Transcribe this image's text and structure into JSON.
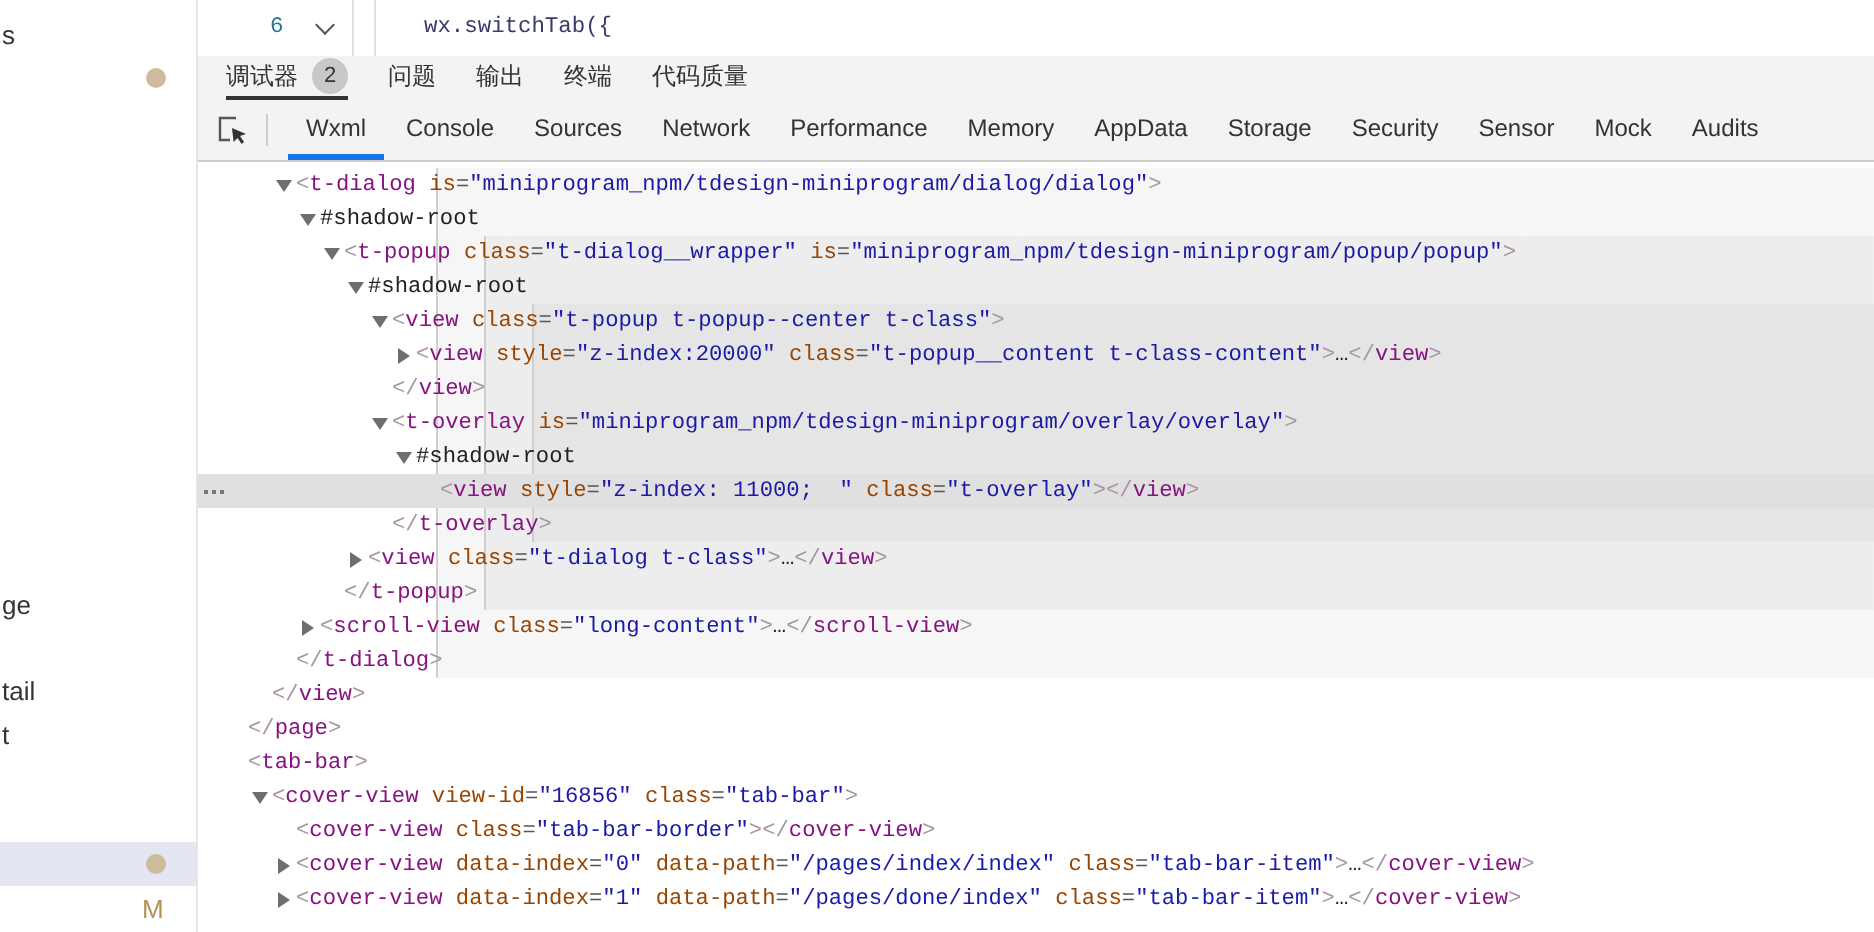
{
  "sidebar": {
    "items": [
      {
        "label": "s",
        "kind": "plain",
        "selected": false
      },
      {
        "kind": "dot",
        "selected": false
      },
      {
        "label": "ge",
        "kind": "plain",
        "selected": false
      },
      {
        "label": "tail",
        "kind": "plain",
        "selected": false
      },
      {
        "label": "t",
        "kind": "plain",
        "selected": false
      },
      {
        "kind": "dot",
        "selected": true
      },
      {
        "kind": "letter",
        "letter": "M",
        "selected": false
      }
    ]
  },
  "editor": {
    "line_number": "6",
    "folded": false,
    "code": "wx.switchTab({"
  },
  "panel_tabs": [
    {
      "label": "调试器",
      "count": "2",
      "selected": true
    },
    {
      "label": "问题",
      "selected": false
    },
    {
      "label": "输出",
      "selected": false
    },
    {
      "label": "终端",
      "selected": false
    },
    {
      "label": "代码质量",
      "selected": false
    }
  ],
  "devtools_tabs": [
    {
      "label": "Wxml",
      "selected": true
    },
    {
      "label": "Console",
      "selected": false
    },
    {
      "label": "Sources",
      "selected": false
    },
    {
      "label": "Network",
      "selected": false
    },
    {
      "label": "Performance",
      "selected": false
    },
    {
      "label": "Memory",
      "selected": false
    },
    {
      "label": "AppData",
      "selected": false
    },
    {
      "label": "Storage",
      "selected": false
    },
    {
      "label": "Security",
      "selected": false
    },
    {
      "label": "Sensor",
      "selected": false
    },
    {
      "label": "Mock",
      "selected": false
    },
    {
      "label": "Audits",
      "selected": false
    }
  ],
  "tree": [
    {
      "selected": false,
      "close": "</page>",
      "children": [
        {
          "selected": false,
          "close": "</view>",
          "children": [
            {
              "text": "<t-dialog is=\"miniprogram_npm/tdesign-miniprogram/dialog/dialog\">",
              "expanded": true,
              "selected": false,
              "close": "</t-dialog>",
              "children": [
                {
                  "text": "#shadow-root",
                  "expanded": true,
                  "selected": false,
                  "children": [
                    {
                      "text": "<t-popup class=\"t-dialog__wrapper\" is=\"miniprogram_npm/tdesign-miniprogram/popup/popup\">",
                      "expanded": true,
                      "selected": false,
                      "close": "</t-popup>",
                      "children": [
                        {
                          "text": "#shadow-root",
                          "expanded": true,
                          "selected": false,
                          "children": [
                            {
                              "text": "<view class=\"t-popup t-popup--center t-class\">",
                              "expanded": true,
                              "selected": false,
                              "close": "</view>",
                              "children": [
                                {
                                  "text": "<view style=\"z-index:20000\" class=\"t-popup__content t-class-content\">…</view>",
                                  "expanded": false,
                                  "selected": false
                                }
                              ]
                            },
                            {
                              "text": "<t-overlay is=\"miniprogram_npm/tdesign-miniprogram/overlay/overlay\">",
                              "expanded": true,
                              "selected": false,
                              "close": "</t-overlay>",
                              "children": [
                                {
                                  "text": "#shadow-root",
                                  "expanded": true,
                                  "selected": false,
                                  "children": [
                                    {
                                      "text": "<view style=\"z-index: 11000;  \" class=\"t-overlay\"></view>",
                                      "selected": true
                                    }
                                  ]
                                }
                              ]
                            }
                          ]
                        },
                        {
                          "text": "<view class=\"t-dialog t-class\">…</view>",
                          "expanded": false,
                          "selected": false
                        }
                      ]
                    }
                  ]
                },
                {
                  "text": "<scroll-view class=\"long-content\">…</scroll-view>",
                  "expanded": false,
                  "selected": false
                }
              ]
            }
          ]
        }
      ]
    },
    {
      "text": "<tab-bar>",
      "selected": false,
      "children": [
        {
          "text": "<cover-view view-id=\"16856\" class=\"tab-bar\">",
          "expanded": true,
          "selected": false,
          "children": [
            {
              "text": "<cover-view class=\"tab-bar-border\"></cover-view>",
              "selected": false
            },
            {
              "text": "<cover-view data-index=\"0\" data-path=\"/pages/index/index\" class=\"tab-bar-item\">…</cover-view>",
              "expanded": false,
              "selected": false
            },
            {
              "text": "<cover-view data-index=\"1\" data-path=\"/pages/done/index\" class=\"tab-bar-item\">…</cover-view>",
              "expanded": false,
              "selected": false
            }
          ]
        }
      ]
    }
  ]
}
